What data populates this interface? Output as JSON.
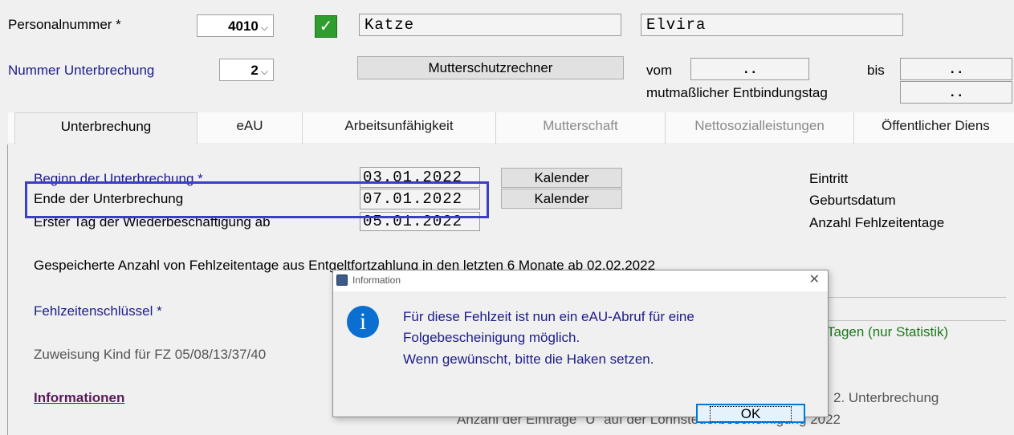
{
  "header": {
    "personalnummer_label": "Personalnummer *",
    "personalnummer_value": "4010",
    "check_icon": "checkmark-icon",
    "lastname": "Katze",
    "firstname": "Elvira",
    "unterbrechung_label": "Nummer Unterbrechung",
    "unterbrechung_value": "2",
    "mutterschutz_button": "Mutterschutzrechner",
    "vom_label": "vom",
    "vom_value": ".   .",
    "bis_label": "bis",
    "bis_value": ".   .",
    "entbindung_label": "mutmaßlicher Entbindungstag",
    "entbindung_value": ".   ."
  },
  "tabs": [
    {
      "label": "Unterbrechung",
      "state": "active"
    },
    {
      "label": "eAU",
      "state": "enabled"
    },
    {
      "label": "Arbeitsunfähigkeit",
      "state": "enabled"
    },
    {
      "label": "Mutterschaft",
      "state": "disabled"
    },
    {
      "label": "Nettosozialleistungen",
      "state": "disabled"
    },
    {
      "label": "Öffentlicher Diens",
      "state": "enabled"
    }
  ],
  "form": {
    "beginn_label": "Beginn der Unterbrechung *",
    "beginn_value": "03.01.2022",
    "ende_label": "Ende der Unterbrechung",
    "ende_value": "07.01.2022",
    "wieder_label": "Erster Tag der Wiederbeschäftigung ab",
    "wieder_value": "05.01.2022",
    "kalender_label": "Kalender",
    "eintritt_label": "Eintritt",
    "geburtsdatum_label": "Geburtsdatum",
    "fehlzeitentage_label": "Anzahl Fehlzeitentage",
    "gespeichert_text": "Gespeicherte Anzahl von Fehlzeitentage aus Entgeltfortzahlung in den letzten 6 Monate ab 02.02.2022",
    "schluessel_label": "Fehlzeitenschlüssel *",
    "tagen_text": "Tagen (nur Statistik)",
    "zuweisung_label": "Zuweisung Kind für FZ 05/08/13/37/40",
    "informationen_link": "Informationen",
    "unterbrechung2_text": "2. Unterbrechung",
    "anzahl_eintraege_text": "Anzahl der Einträge \"U\" auf der Lohnsteuerbescheinigung 2022"
  },
  "dialog": {
    "title": "Information",
    "line1": "Für diese Fehlzeit ist nun ein eAU-Abruf für eine",
    "line2": "Folgebescheinigung möglich.",
    "line3": "Wenn gewünscht, bitte die Haken setzen.",
    "ok_label": "OK",
    "info_icon": "info-icon",
    "close_icon": "close-icon"
  },
  "colors": {
    "accent_navy": "#1c1c8c",
    "highlight_box": "#3a3fc4",
    "check_green": "#2e9d2e",
    "info_blue": "#0a6fd1",
    "dark_green": "#1b7a1b",
    "link_purple": "#5a1a5a"
  }
}
